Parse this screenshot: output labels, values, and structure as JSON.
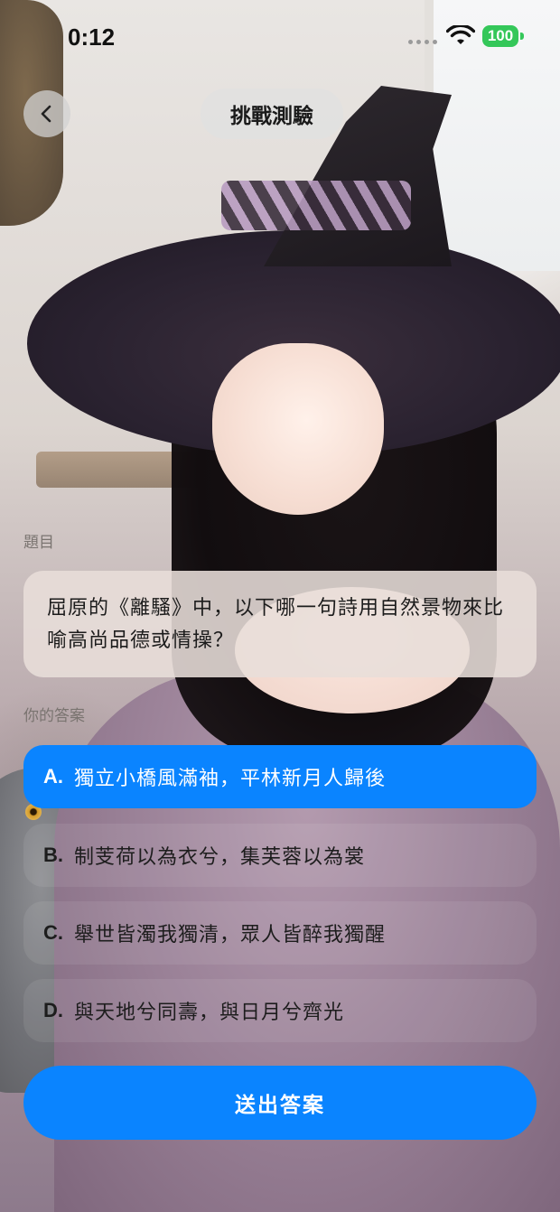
{
  "status_bar": {
    "time": "0:12",
    "battery": "100",
    "battery_color": "#34c759"
  },
  "nav": {
    "back_icon": "chevron-left-icon",
    "title": "挑戰測驗"
  },
  "question": {
    "label": "題目",
    "text": "屈原的《離騷》中，以下哪一句詩用自然景物來比喻高尚品德或情操？"
  },
  "answer": {
    "label": "你的答案",
    "options": [
      {
        "letter": "A.",
        "text": "獨立小橋風滿袖，平林新月人歸後",
        "selected": true
      },
      {
        "letter": "B.",
        "text": "制芰荷以為衣兮，集芙蓉以為裳",
        "selected": false
      },
      {
        "letter": "C.",
        "text": "舉世皆濁我獨清，眾人皆醉我獨醒",
        "selected": false
      },
      {
        "letter": "D.",
        "text": "與天地兮同壽，與日月兮齊光",
        "selected": false
      }
    ]
  },
  "submit": {
    "label": "送出答案"
  },
  "colors": {
    "accent": "#0a84ff"
  }
}
